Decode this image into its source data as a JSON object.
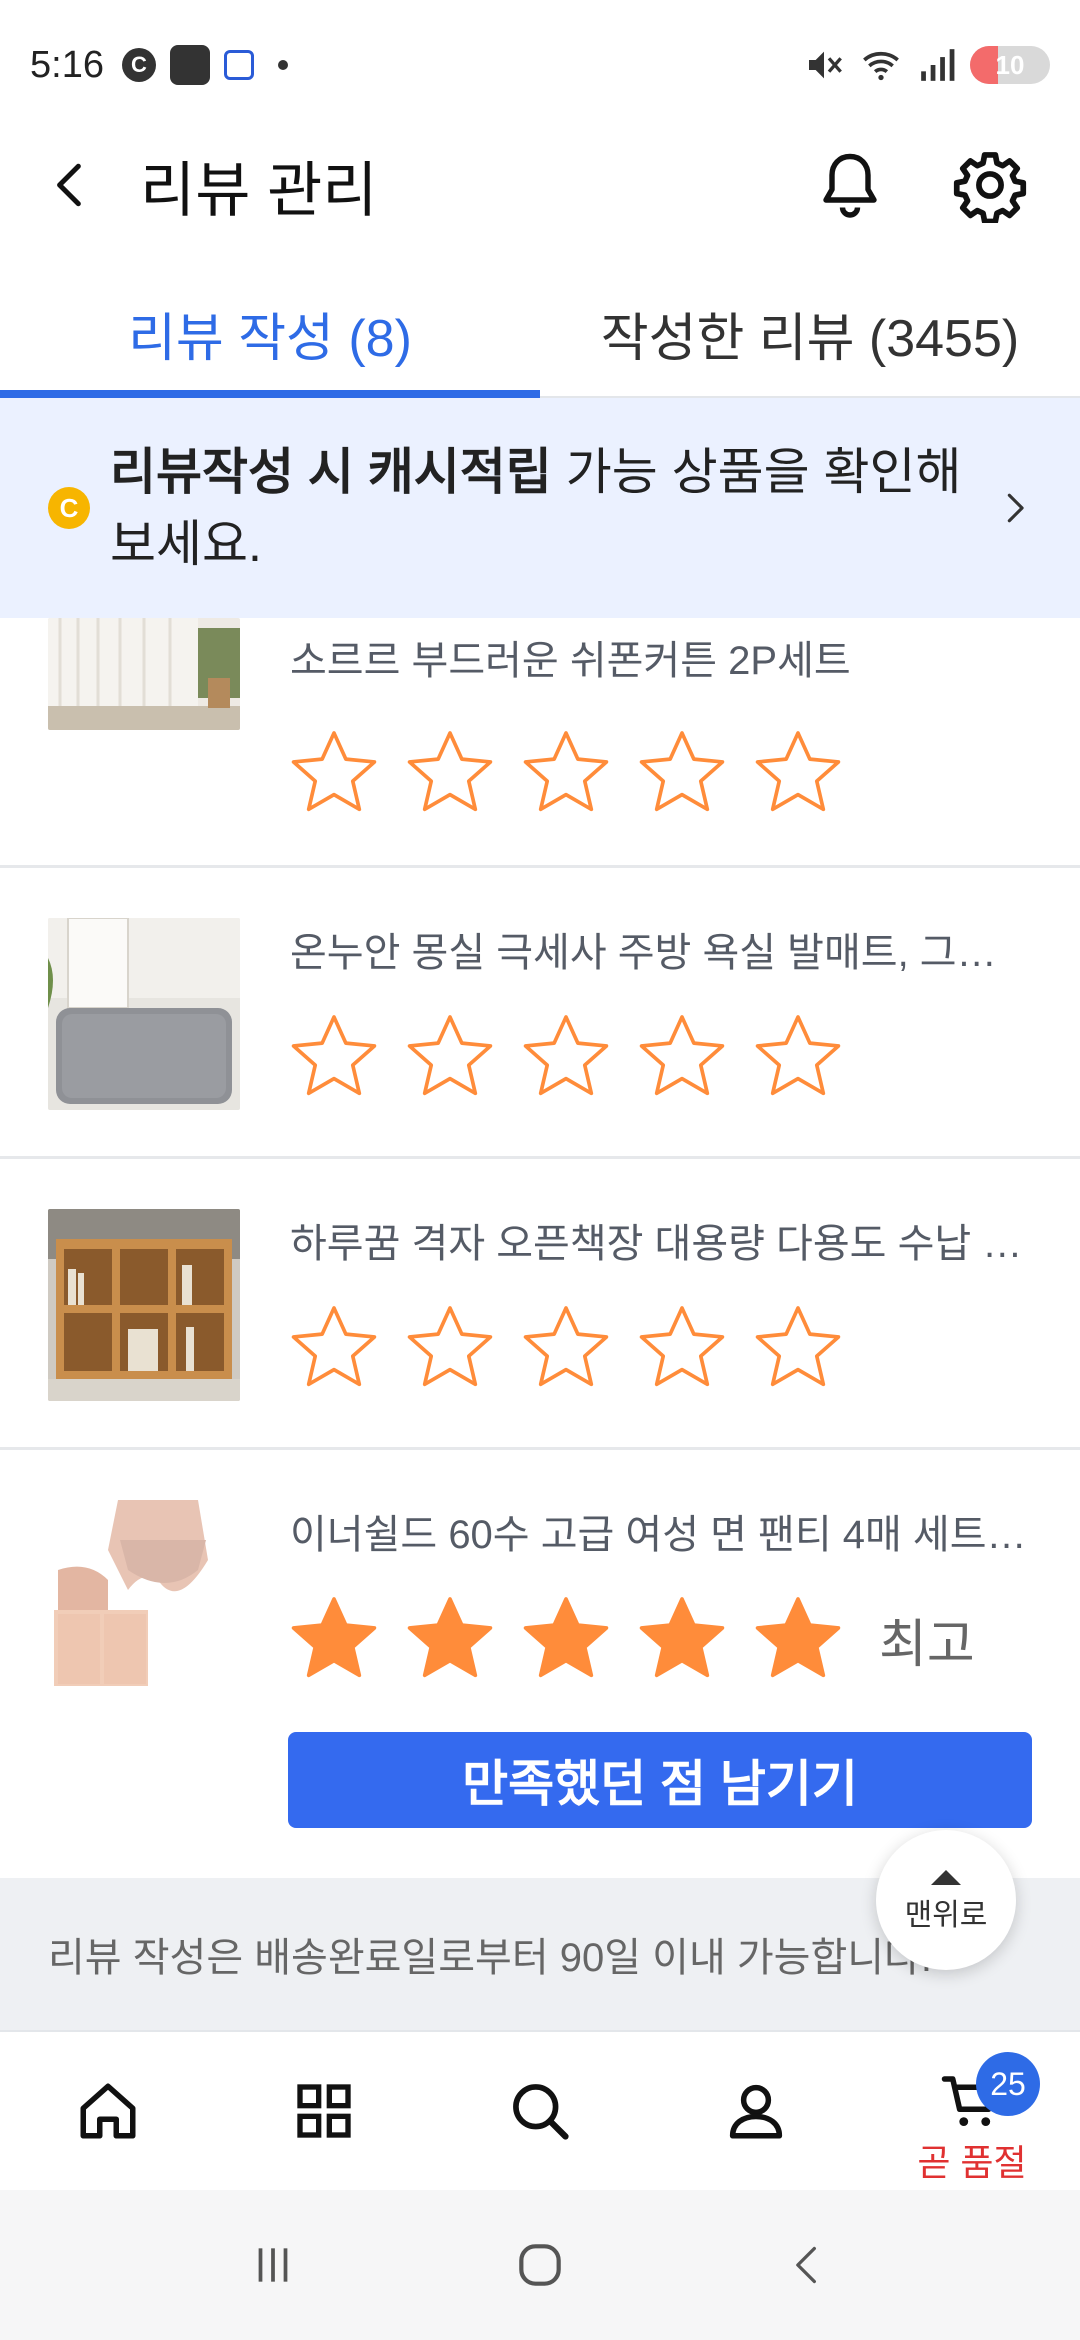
{
  "status_bar": {
    "time": "5:16",
    "left_icons": [
      "c-circle-icon",
      "samsung-lounge-icon",
      "shield-app-icon",
      "dot-icon"
    ],
    "right_icons": [
      "mute-icon",
      "wifi-icon",
      "signal-icon"
    ],
    "battery": "10",
    "battery_level": 0.1
  },
  "header": {
    "title": "리뷰 관리",
    "icons": [
      "back-icon",
      "bell-icon",
      "gear-icon"
    ]
  },
  "tabs": [
    {
      "label": "리뷰 작성 (8)",
      "active": true
    },
    {
      "label": "작성한 리뷰 (3455)",
      "active": false
    }
  ],
  "banner": {
    "icon_text": "C",
    "bold_text": "리뷰작성 시 캐시적립",
    "rest_text": " 가능 상품을 확인해보세요."
  },
  "items": [
    {
      "name": "소르르 부드러운 쉬폰커튼 2P세트",
      "rating": 0
    },
    {
      "name": "온누안 몽실 극세사 주방 욕실 발매트, 그레이",
      "rating": 0
    },
    {
      "name": "하루꿈 격자 오픈책장 대용량 다용도 수납 진...",
      "rating": 0
    },
    {
      "name": "이너쉴드 60수 고급 여성 면 팬티 4매 세트 ...",
      "rating": 5,
      "rating_label": "최고",
      "button_label": "만족했던 점 남기기"
    }
  ],
  "notice": "리뷰 작성은 배송완료일로부터 90일 이내 가능합니다.",
  "top_button": "맨위로",
  "bottom_nav": {
    "items": [
      "home-icon",
      "category-icon",
      "search-icon",
      "profile-icon",
      "cart-icon"
    ],
    "cart_badge": "25",
    "cart_sub": "곧 품절"
  },
  "colors": {
    "accent": "#2e6be6",
    "star": "#ff8c3a",
    "banner_bg": "#ebf1ff",
    "button": "#346aef"
  }
}
